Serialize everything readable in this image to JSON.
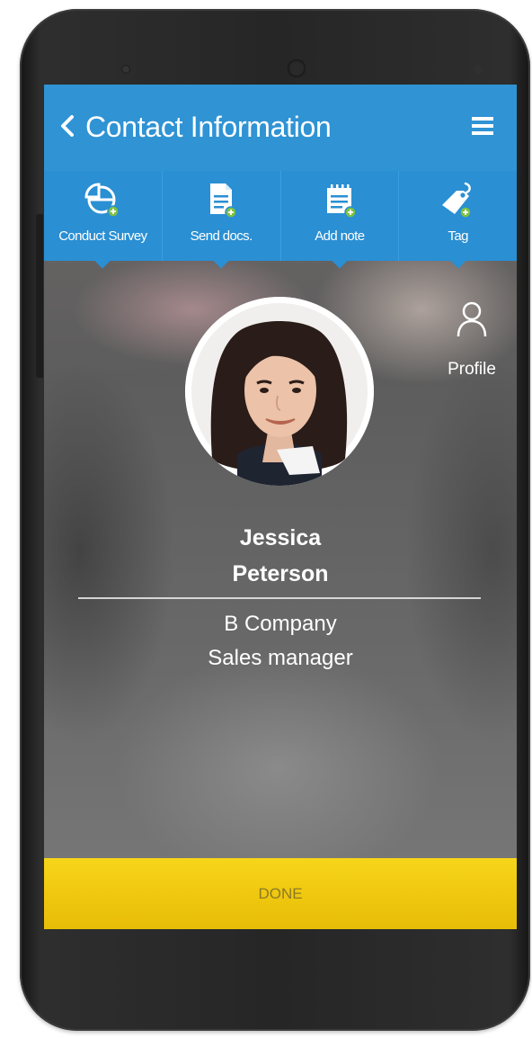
{
  "header": {
    "title": "Contact Information"
  },
  "actions": [
    {
      "label": "Conduct Survey",
      "icon": "survey-icon"
    },
    {
      "label": "Send docs.",
      "icon": "document-icon"
    },
    {
      "label": "Add note",
      "icon": "note-icon"
    },
    {
      "label": "Tag",
      "icon": "tag-icon"
    }
  ],
  "profile": {
    "label": "Profile",
    "icon": "person-icon"
  },
  "contact": {
    "first_name": "Jessica",
    "last_name": "Peterson",
    "company": "B Company",
    "role": "Sales manager"
  },
  "footer": {
    "done_label": "DONE"
  },
  "colors": {
    "appbar": "#2f93d4",
    "toolbar": "#2a8fd3",
    "accent_green": "#7dc142",
    "done_button": "#f0c80f"
  }
}
